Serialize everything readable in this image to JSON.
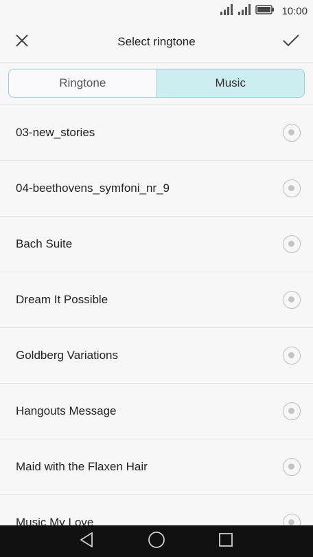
{
  "status_bar": {
    "time": "10:00",
    "icons": [
      "signal-icon",
      "signal-icon",
      "battery-icon"
    ]
  },
  "header": {
    "title": "Select ringtone",
    "close_icon": "close-icon",
    "confirm_icon": "checkmark-icon"
  },
  "tabs": [
    {
      "label": "Ringtone",
      "active": false
    },
    {
      "label": "Music",
      "active": true
    }
  ],
  "items": [
    {
      "label": "03-new_stories"
    },
    {
      "label": "04-beethovens_symfoni_nr_9"
    },
    {
      "label": "Bach Suite"
    },
    {
      "label": "Dream It Possible"
    },
    {
      "label": "Goldberg Variations"
    },
    {
      "label": "Hangouts Message"
    },
    {
      "label": "Maid with the Flaxen Hair"
    },
    {
      "label": "Music My Love"
    }
  ],
  "nav_bar": {
    "icons": [
      "back-icon",
      "home-icon",
      "recents-icon"
    ]
  },
  "colors": {
    "accent_border": "#8fd0d8",
    "active_tab_bg": "#cdeef1",
    "background": "#f7f7f7"
  }
}
